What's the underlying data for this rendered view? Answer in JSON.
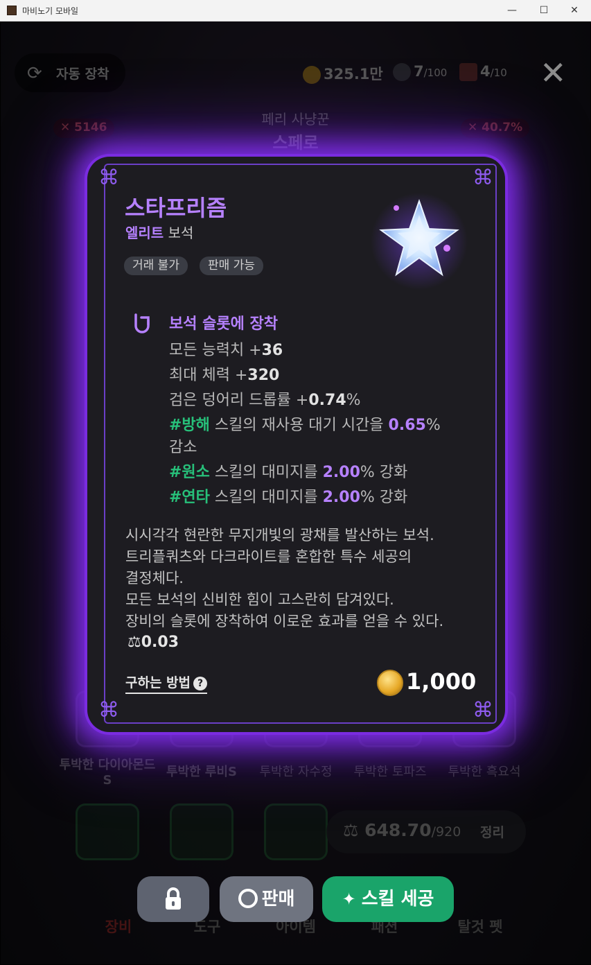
{
  "window": {
    "title": "마비노기 모바일",
    "minimize": "—",
    "maximize": "☐",
    "close": "✕"
  },
  "topbar": {
    "auto_equip_label": "자동 장착",
    "gold": "325.1만",
    "gems": "7",
    "gems_max": "/100",
    "badges": "4",
    "badges_max": "/10"
  },
  "character": {
    "subtitle": "페리 사냥꾼",
    "name": "스페로",
    "power": "5146",
    "rate": "40.7%"
  },
  "background": {
    "gem_labels": [
      "투박한 다이아몬드S",
      "투박한 루비S",
      "투박한 자수정",
      "투박한 토파즈",
      "투박한 흑요석"
    ],
    "weight": "648.70",
    "weight_max": "/920",
    "sort_label": "정리",
    "tabs": [
      "장비",
      "도구",
      "아이템",
      "패션",
      "탈것 펫"
    ]
  },
  "item": {
    "name": "스타프리즘",
    "grade": "엘리트",
    "category": "보석",
    "tags": [
      "거래 불가",
      "판매 가능"
    ],
    "effect_title": "보석 슬롯에 장착",
    "effects": {
      "l1a": "모든 능력치 +",
      "l1b": "36",
      "l2a": "최대 체력 +",
      "l2b": "320",
      "l3a": "검은 덩어리 드롭률 +",
      "l3b": "0.74",
      "l3c": "%",
      "l4tag": "#방해",
      "l4a": " 스킬의 재사용 대기 시간을 ",
      "l4b": "0.65",
      "l4c": "%",
      "l4d": "감소",
      "l5tag": "#원소",
      "l5a": " 스킬의 대미지를 ",
      "l5b": "2.00",
      "l5c": "% 강화",
      "l6tag": "#연타",
      "l6a": " 스킬의 대미지를 ",
      "l6b": "2.00",
      "l6c": "% 강화"
    },
    "description": [
      "시시각각 현란한 무지개빛의 광채를 발산하는 보석.",
      "트리플쿼츠와 다크라이트를 혼합한 특수 세공의",
      "결정체다.",
      "모든 보석의 신비한 힘이 고스란히 담겨있다.",
      "장비의 슬롯에 장착하여 이로운 효과를 얻을 수 있다."
    ],
    "weight": "0.03",
    "how_to_obtain": "구하는 방법",
    "price": "1,000"
  },
  "actions": {
    "sell_label": "판매",
    "craft_label": "스킬 세공"
  },
  "colors": {
    "accent_purple": "#b681ff",
    "glow_purple": "#7a2ce0",
    "green": "#1aa46a",
    "skill_tag_green": "#27c07a"
  }
}
